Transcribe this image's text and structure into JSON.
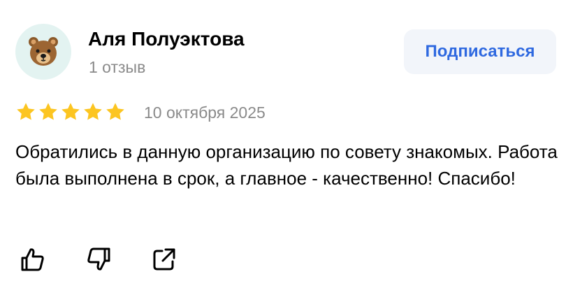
{
  "author": {
    "name": "Аля Полуэктова",
    "meta": "1 отзыв",
    "avatar_icon": "bear-face-icon",
    "avatar_bg": "#e3f3f1"
  },
  "subscribe": {
    "label": "Подписаться",
    "color": "#2f69e0"
  },
  "review": {
    "rating": 5,
    "rating_max": 5,
    "star_color": "#fcc521",
    "date": "10 октября 2025",
    "text": "Обратились в данную организацию по совету знакомых. Работа была выполнена в срок, а главное - качественно! Спасибо!"
  },
  "actions": [
    {
      "icon": "thumbs-up-icon"
    },
    {
      "icon": "thumbs-down-icon"
    },
    {
      "icon": "share-icon"
    }
  ]
}
